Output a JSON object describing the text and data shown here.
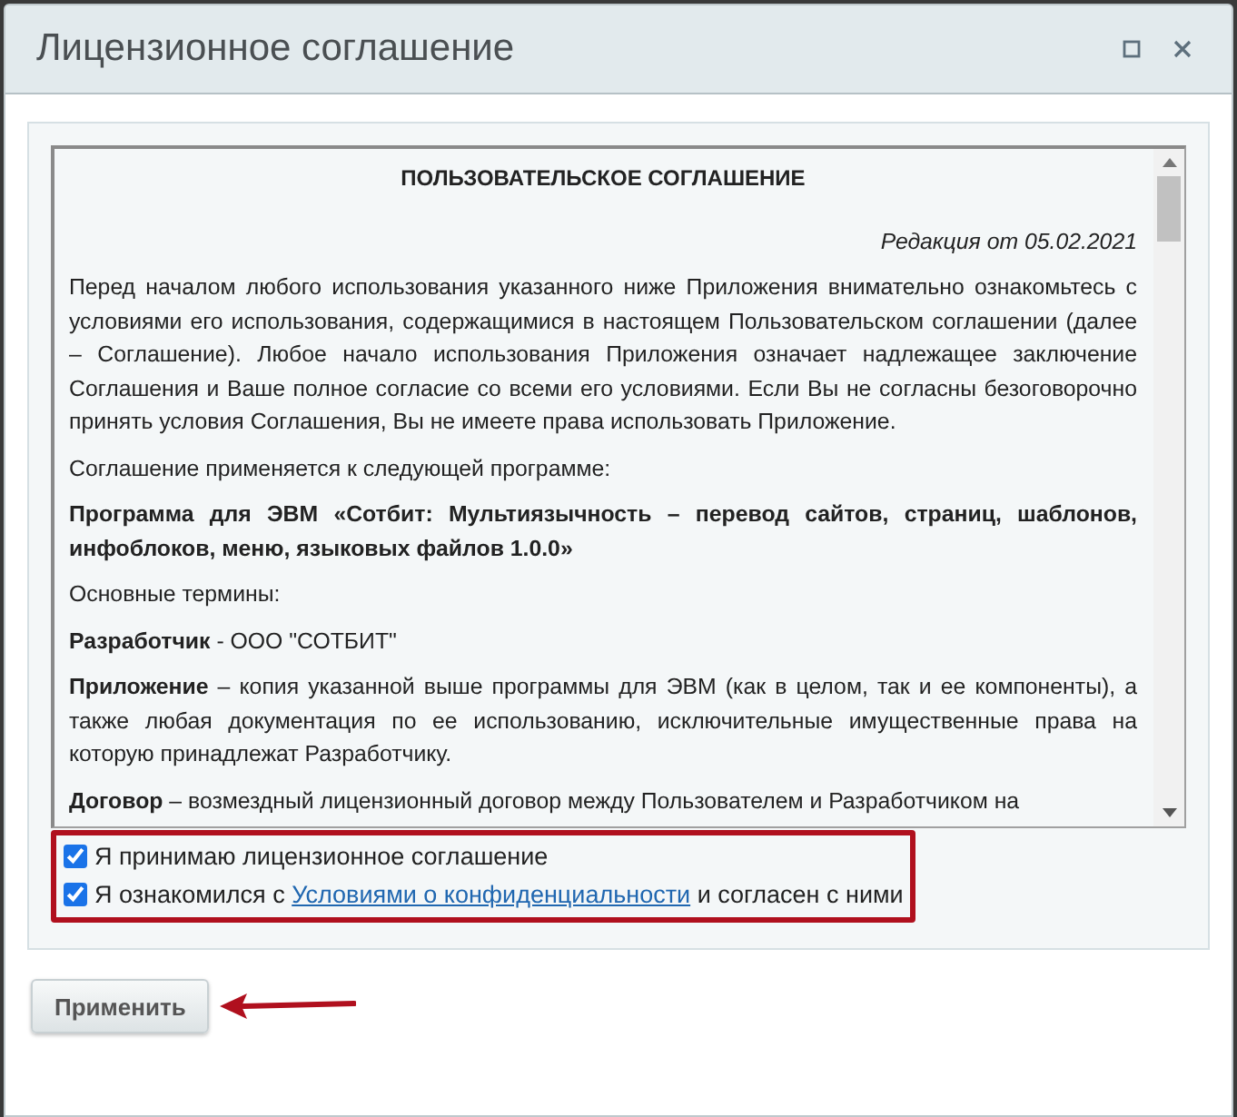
{
  "window": {
    "title": "Лицензионное соглашение"
  },
  "document": {
    "blocks": [
      {
        "kind": "heading",
        "text": "ПОЛЬЗОВАТЕЛЬСКОЕ СОГЛАШЕНИЕ"
      },
      {
        "kind": "edition",
        "text": "Редакция от 05.02.2021"
      },
      {
        "kind": "paragraph",
        "text": "Перед началом любого использования указанного ниже Приложения внимательно ознакомьтесь с условиями его использования, содержащимися в настоящем Пользовательском соглашении (далее – Соглашение). Любое начало использования Приложения означает надлежащее заключение Соглашения и Ваше полное согласие со всеми его условиями. Если Вы не согласны безоговорочно принять условия Соглашения, Вы не имеете права использовать Приложение."
      },
      {
        "kind": "paragraph",
        "text": "Соглашение применяется к следующей программе:"
      },
      {
        "kind": "bold",
        "text": "Программа для ЭВМ «Сотбит: Мультиязычность – перевод сайтов, страниц, шаблонов, инфоблоков, меню, языковых файлов 1.0.0»"
      },
      {
        "kind": "paragraph",
        "text": "Основные термины:"
      },
      {
        "kind": "paragraph",
        "text": "**Разработчик** - ООО \"СОТБИТ\""
      },
      {
        "kind": "paragraph",
        "text": "**Приложение** – копия указанной выше программы для ЭВМ (как в целом, так и ее компоненты), а также любая документация по ее использованию, исключительные имущественные права на которую принадлежат Разработчику."
      },
      {
        "kind": "paragraph",
        "text": "**Договор** – возмездный лицензионный договор между Пользователем и Разработчиком на"
      }
    ]
  },
  "consents": [
    {
      "text": "Я принимаю лицензионное соглашение",
      "checked": true
    },
    {
      "text_before": "Я ознакомился с",
      "link": "Условиями о конфиденциальности",
      "text_after": "и согласен с ними",
      "checked": true
    }
  ],
  "buttons": [
    {
      "label": "Применить"
    }
  ]
}
